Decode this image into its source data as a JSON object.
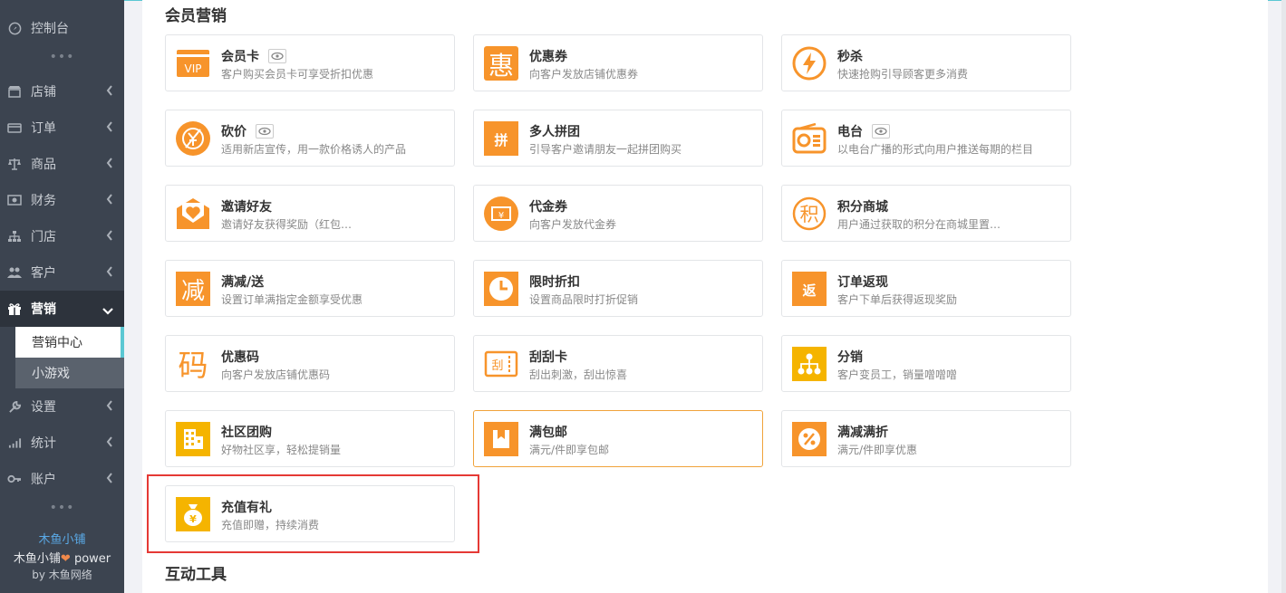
{
  "sidebar": {
    "items": [
      {
        "label": "控制台",
        "icon": "dashboard-icon"
      },
      {
        "label": "店铺",
        "icon": "shop-icon"
      },
      {
        "label": "订单",
        "icon": "order-icon"
      },
      {
        "label": "商品",
        "icon": "scale-icon"
      },
      {
        "label": "财务",
        "icon": "money-icon"
      },
      {
        "label": "门店",
        "icon": "sitemap-icon"
      },
      {
        "label": "客户",
        "icon": "users-icon"
      },
      {
        "label": "营销",
        "icon": "gift-icon"
      },
      {
        "label": "设置",
        "icon": "wrench-icon"
      },
      {
        "label": "统计",
        "icon": "bar-chart-icon"
      },
      {
        "label": "账户",
        "icon": "key-icon"
      }
    ],
    "submenu": [
      {
        "label": "营销中心"
      },
      {
        "label": "小游戏"
      }
    ],
    "dots": "•••",
    "brand_name": "木鱼小铺",
    "brand_power": "木鱼小铺",
    "brand_power_suffix": "power",
    "brand_by": "by 木鱼网络"
  },
  "sections": {
    "member_marketing": "会员营销",
    "interactive_tools": "互动工具"
  },
  "cards": [
    {
      "title": "会员卡",
      "desc": "客户购买会员卡可享受折扣优惠",
      "icon": "vip-icon",
      "eye": true
    },
    {
      "title": "优惠券",
      "desc": "向客户发放店铺优惠券",
      "icon": "hui-icon",
      "glyph": "惠"
    },
    {
      "title": "秒杀",
      "desc": "快速抢购引导顾客更多消费",
      "icon": "lightning-icon"
    },
    {
      "title": "砍价",
      "desc": "适用新店宣传，用一款价格诱人的产品",
      "icon": "bargain-icon",
      "eye": true
    },
    {
      "title": "多人拼团",
      "desc": "引导客户邀请朋友一起拼团购买",
      "icon": "pin-icon",
      "glyph": "拼"
    },
    {
      "title": "电台",
      "desc": "以电台广播的形式向用户推送每期的栏目",
      "icon": "radio-icon",
      "eye": true
    },
    {
      "title": "邀请好友",
      "desc": "邀请好友获得奖励（红包、优惠券）",
      "icon": "invite-envelope-icon"
    },
    {
      "title": "代金券",
      "desc": "向客户发放代金券",
      "icon": "voucher-icon"
    },
    {
      "title": "积分商城",
      "desc": "用户通过获取的积分在商城里置换商品",
      "icon": "points-icon",
      "glyph": "积"
    },
    {
      "title": "满减/送",
      "desc": "设置订单满指定金额享受优惠",
      "icon": "jian-icon",
      "glyph": "减"
    },
    {
      "title": "限时折扣",
      "desc": "设置商品限时打折促销",
      "icon": "clock-icon"
    },
    {
      "title": "订单返现",
      "desc": "客户下单后获得返现奖励",
      "icon": "cashback-icon",
      "glyph": "返"
    },
    {
      "title": "优惠码",
      "desc": "向客户发放店铺优惠码",
      "icon": "ma-icon",
      "glyph": "码"
    },
    {
      "title": "刮刮卡",
      "desc": "刮出刺激，刮出惊喜",
      "icon": "scratch-card-icon",
      "glyph": "刮"
    },
    {
      "title": "分销",
      "desc": "客户变员工，销量噌噌噌",
      "icon": "distribution-icon"
    },
    {
      "title": "社区团购",
      "desc": "好物社区享，轻松提销量",
      "icon": "building-icon"
    },
    {
      "title": "满包邮",
      "desc": "满元/件即享包邮",
      "icon": "package-icon"
    },
    {
      "title": "满减满折",
      "desc": "满元/件即享优惠",
      "icon": "percent-icon"
    },
    {
      "title": "充值有礼",
      "desc": "充值即赠，持续消费",
      "icon": "money-bag-icon",
      "glyph": "¥"
    }
  ],
  "colors": {
    "sidebar_bg": "#3c4450",
    "accent": "#5bc8d3",
    "orange": "#f7942b",
    "yellow": "#f5b400",
    "highlight_border": "#e53935"
  }
}
